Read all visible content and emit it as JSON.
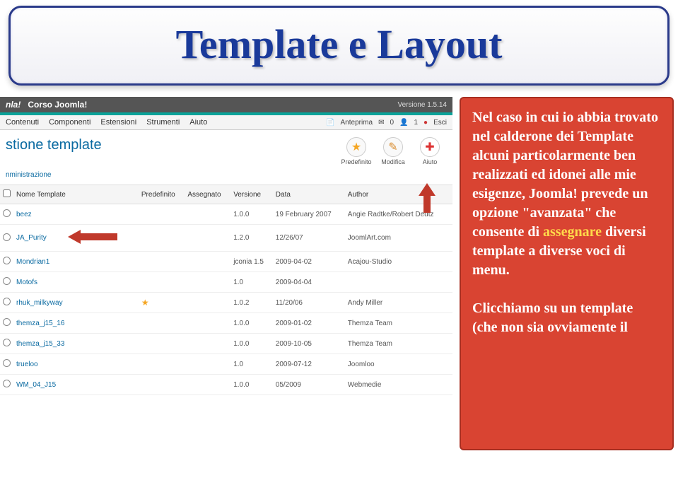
{
  "banner": {
    "title": "Template e Layout"
  },
  "topbar": {
    "brand": "nla!",
    "site": "Corso Joomla!",
    "version": "Versione 1.5.14"
  },
  "menubar": {
    "items": [
      "Contenuti",
      "Componenti",
      "Estensioni",
      "Strumenti",
      "Aiuto"
    ],
    "right": {
      "anteprima": "Anteprima",
      "n0": "0",
      "n1": "1",
      "esci": "Esci"
    }
  },
  "page": {
    "title": "stione template",
    "breadcrumb": "nministrazione"
  },
  "toolbar": {
    "predefinito": {
      "label": "Predefinito",
      "glyph": "★"
    },
    "modifica": {
      "label": "Modifica",
      "glyph": "✎"
    },
    "aiuto": {
      "label": "Aiuto",
      "glyph": "✚"
    }
  },
  "table": {
    "headers": {
      "chk": "",
      "nome": "Nome Template",
      "predef": "Predefinito",
      "asseg": "Assegnato",
      "ver": "Versione",
      "data": "Data",
      "author": "Author"
    },
    "rows": [
      {
        "name": "beez",
        "predef": "",
        "asseg": "",
        "ver": "1.0.0",
        "data": "19 February 2007",
        "author": "Angie Radtke/Robert Deutz"
      },
      {
        "name": "JA_Purity",
        "predef": "",
        "asseg": "",
        "ver": "1.2.0",
        "data": "12/26/07",
        "author": "JoomlArt.com",
        "arrow": true
      },
      {
        "name": "Mondrian1",
        "predef": "",
        "asseg": "",
        "ver": "jconia 1.5",
        "data": "2009-04-02",
        "author": "Acajou-Studio"
      },
      {
        "name": "Motofs",
        "predef": "",
        "asseg": "",
        "ver": "1.0",
        "data": "2009-04-04",
        "author": ""
      },
      {
        "name": "rhuk_milkyway",
        "predef": "star",
        "asseg": "",
        "ver": "1.0.2",
        "data": "11/20/06",
        "author": "Andy Miller"
      },
      {
        "name": "themza_j15_16",
        "predef": "",
        "asseg": "",
        "ver": "1.0.0",
        "data": "2009-01-02",
        "author": "Themza Team"
      },
      {
        "name": "themza_j15_33",
        "predef": "",
        "asseg": "",
        "ver": "1.0.0",
        "data": "2009-10-05",
        "author": "Themza Team"
      },
      {
        "name": "trueloo",
        "predef": "",
        "asseg": "",
        "ver": "1.0",
        "data": "2009-07-12",
        "author": "Joomloo"
      },
      {
        "name": "WM_04_J15",
        "predef": "",
        "asseg": "",
        "ver": "1.0.0",
        "data": "05/2009",
        "author": "Webmedie"
      }
    ]
  },
  "callout": {
    "p1a": "Nel caso in cui io abbia trovato nel calderone dei Template alcuni particolarmente ben realizzati ed idonei alle mie esigenze, Joomla! prevede un opzione \"avanzata\" che consente di ",
    "p1_hl": "assegnare",
    "p1b": " diversi template a diverse voci di menu.",
    "p2": "Clicchiamo su un template (che non sia ovviamente il"
  }
}
